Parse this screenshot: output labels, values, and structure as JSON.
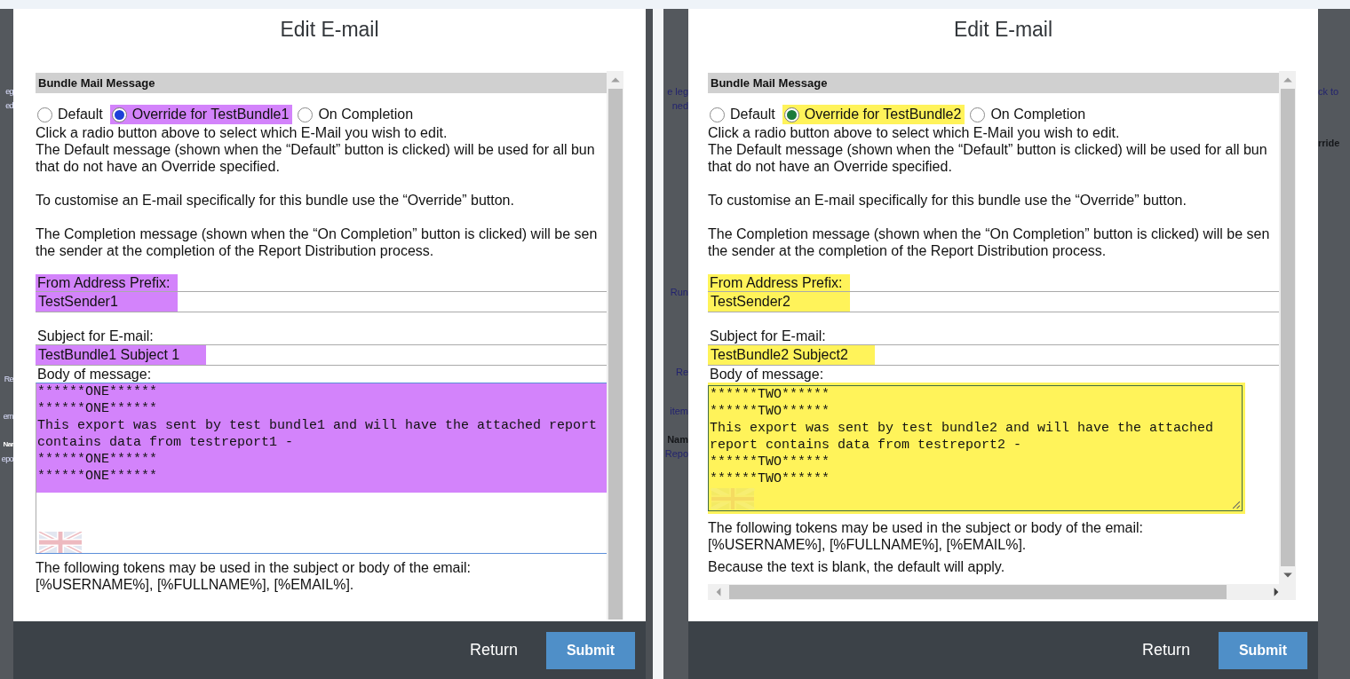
{
  "background_fragments": {
    "left": [
      "eg",
      "ed",
      "Re",
      "em",
      "Nar",
      "epo"
    ],
    "middle": [
      "e leg",
      "ned",
      "Run",
      "Re",
      "item",
      "Nam",
      "Repo"
    ],
    "right": [
      "ck to",
      "rride"
    ]
  },
  "dialogs": [
    {
      "title": "Edit E-mail",
      "color": "#1c3fd8",
      "highlight": {
        "color": "#d383fb"
      },
      "section_title": "Bundle Mail Message",
      "options": [
        {
          "label": "Default",
          "selected": false
        },
        {
          "label": "Override for TestBundle1",
          "selected": true
        },
        {
          "label": "On Completion",
          "selected": false
        }
      ],
      "paragraphs": [
        [
          "Click a radio button above to select which E-Mail you wish to edit.",
          "The Default message (shown when the “Default” button is clicked) will be used for all bun",
          "that do not have an Override specified."
        ],
        [
          "To customise an E-mail specifically for this bundle use the “Override” button."
        ],
        [
          "The Completion message (shown when the “On Completion” button is clicked) will be sen",
          "the sender at the completion of the Report Distribution process."
        ]
      ],
      "from_label": "From Address Prefix:",
      "from_value": "TestSender1",
      "subject_label": "Subject for E-mail:",
      "subject_value": "TestBundle1 Subject 1",
      "body": {
        "label": "Body of message:",
        "kind": "text",
        "lines": [
          "******ONE******",
          "******ONE******",
          "This export was sent by test bundle1 and will have the attached report",
          "contains data from testreport1 -",
          "******ONE******",
          "******ONE******"
        ]
      },
      "tokens": [
        "The following tokens may be used in the subject or body of the email:",
        "[%USERNAME%], [%FULLNAME%], [%EMAIL%]."
      ],
      "return_label": "Return",
      "submit_label": "Submit"
    },
    {
      "title": "Edit E-mail",
      "color": "#1b7a3a",
      "highlight": {
        "color": "#fff35a"
      },
      "section_title": "Bundle Mail Message",
      "options": [
        {
          "label": "Default",
          "selected": false
        },
        {
          "label": "Override for TestBundle2",
          "selected": true
        },
        {
          "label": "On Completion",
          "selected": false
        }
      ],
      "paragraphs": [
        [
          "Click a radio button above to select which E-Mail you wish to edit.",
          "The Default message (shown when the “Default” button is clicked) will be used for all bun",
          "that do not have an Override specified."
        ],
        [
          "To customise an E-mail specifically for this bundle use the “Override” button."
        ],
        [
          "The Completion message (shown when the “On Completion” button is clicked) will be sen",
          "the sender at the completion of the Report Distribution process."
        ]
      ],
      "from_label": "From Address Prefix:",
      "from_value": "TestSender2",
      "subject_label": "Subject for E-mail:",
      "subject_value": "TestBundle2 Subject2",
      "body": {
        "label": "Body of message:",
        "kind": "box",
        "lines": [
          "******TWO******",
          "******TWO******",
          "This export was sent by test bundle2 and will have the attached",
          "report contains data from testreport2 -",
          "******TWO******",
          "******TWO******"
        ]
      },
      "tokens": [
        "The following tokens may be used in the subject or body of the email:",
        "[%USERNAME%], [%FULLNAME%], [%EMAIL%]."
      ],
      "note": "Because the text is blank, the default will apply.",
      "horizontal_scrollbar": true,
      "return_label": "Return",
      "submit_label": "Submit"
    }
  ]
}
